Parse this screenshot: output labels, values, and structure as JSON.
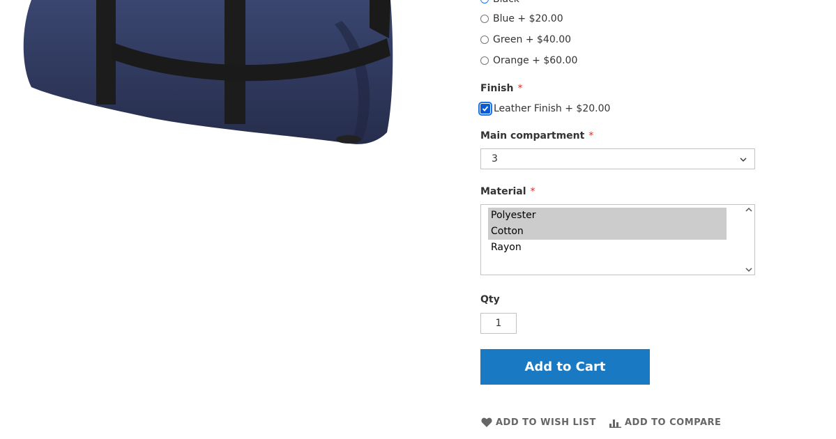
{
  "product_image": {
    "alt": "duffel bag"
  },
  "color": {
    "options": [
      {
        "label": "Black"
      },
      {
        "label": "Blue + $20.00"
      },
      {
        "label": "Green + $40.00"
      },
      {
        "label": "Orange + $60.00"
      }
    ]
  },
  "finish": {
    "label": "Finish",
    "required_mark": "*",
    "option_label": "Leather Finish + $20.00",
    "checked": true
  },
  "main_compartment": {
    "label": "Main compartment",
    "required_mark": "*",
    "value": "3"
  },
  "material": {
    "label": "Material",
    "required_mark": "*",
    "options": [
      {
        "label": "Polyester",
        "selected": true
      },
      {
        "label": "Cotton",
        "selected": true
      },
      {
        "label": "Rayon",
        "selected": false
      }
    ]
  },
  "qty": {
    "label": "Qty",
    "value": "1"
  },
  "add_to_cart": {
    "label": "Add to Cart"
  },
  "actions": {
    "wishlist": "ADD TO WISH LIST",
    "compare": "ADD TO COMPARE"
  },
  "colors": {
    "primary": "#1979c3",
    "required": "#e02b27",
    "selection": "#cccccc"
  }
}
